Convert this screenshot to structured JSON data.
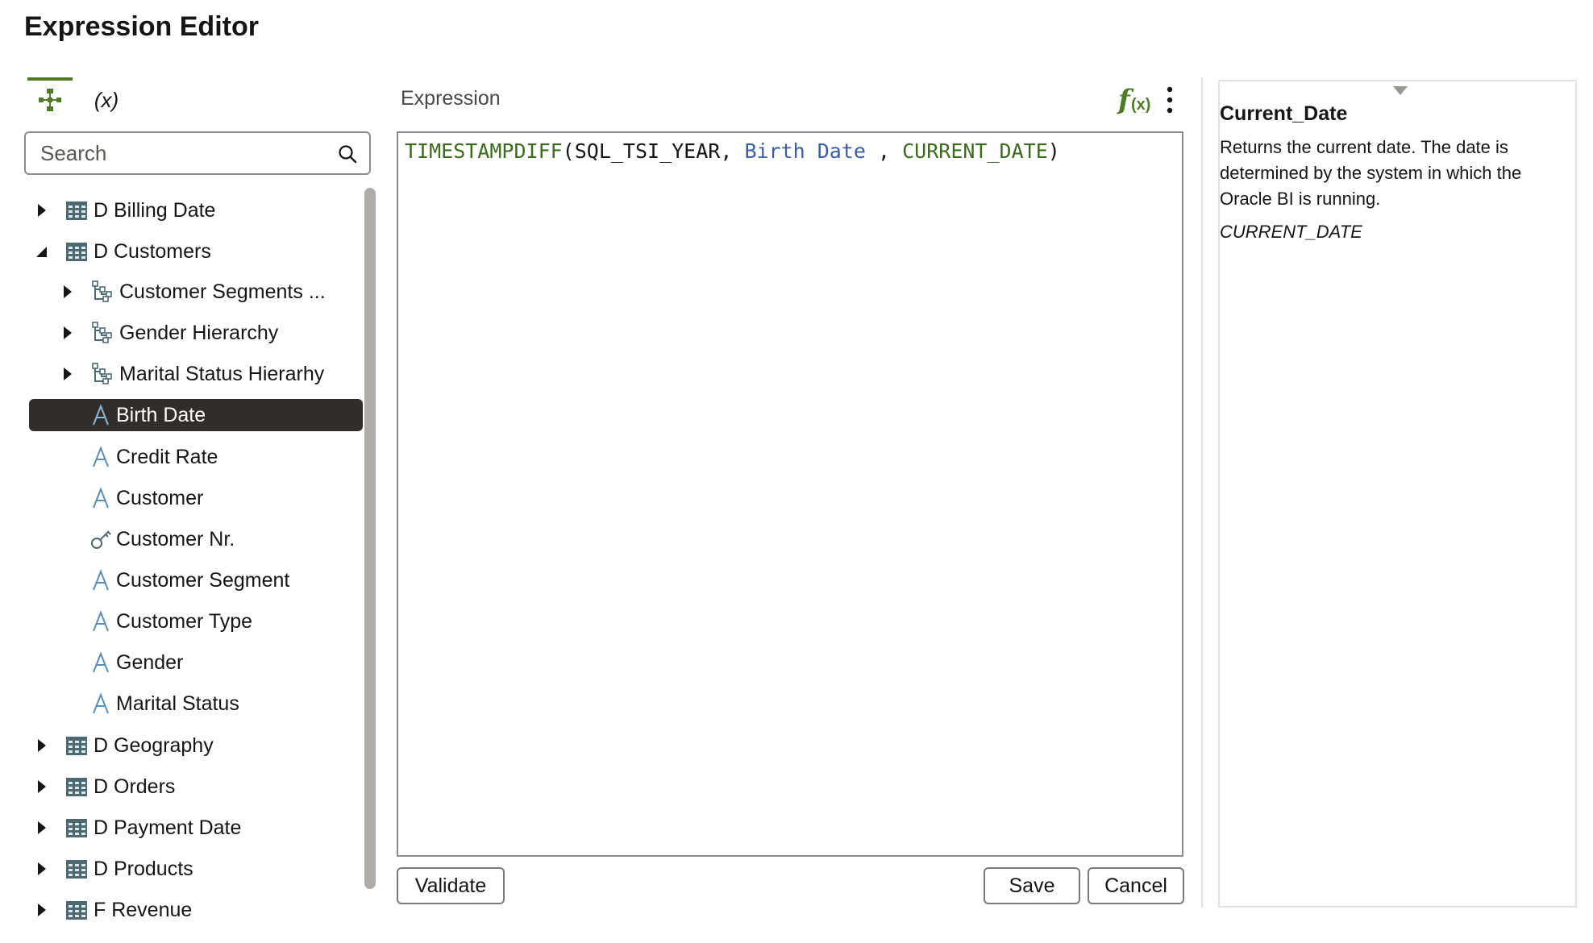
{
  "page": {
    "title": "Expression Editor"
  },
  "left_tabs": [
    {
      "name": "fields-tab",
      "icon": "fields-icon",
      "label": ""
    },
    {
      "name": "variables-tab",
      "label": "(x)"
    }
  ],
  "search": {
    "placeholder": "Search",
    "value": ""
  },
  "tree": {
    "items": [
      {
        "label": "D Billing Date",
        "icon": "table-icon",
        "expander": "collapsed",
        "level": 0
      },
      {
        "label": "D Customers",
        "icon": "table-icon",
        "expander": "expanded",
        "level": 0
      },
      {
        "label": "Customer Segments ...",
        "icon": "hierarchy-icon",
        "expander": "collapsed",
        "level": 1
      },
      {
        "label": "Gender Hierarchy",
        "icon": "hierarchy-icon",
        "expander": "collapsed",
        "level": 1
      },
      {
        "label": "Marital Status Hierarhy",
        "icon": "hierarchy-icon",
        "expander": "collapsed",
        "level": 1
      },
      {
        "label": "Birth Date",
        "icon": "attribute-icon",
        "expander": "none",
        "level": 2,
        "selected": true
      },
      {
        "label": "Credit Rate",
        "icon": "attribute-icon",
        "expander": "none",
        "level": 2
      },
      {
        "label": "Customer",
        "icon": "attribute-icon",
        "expander": "none",
        "level": 2
      },
      {
        "label": "Customer Nr.",
        "icon": "key-icon",
        "expander": "none",
        "level": 2
      },
      {
        "label": "Customer Segment",
        "icon": "attribute-icon",
        "expander": "none",
        "level": 2
      },
      {
        "label": "Customer Type",
        "icon": "attribute-icon",
        "expander": "none",
        "level": 2
      },
      {
        "label": "Gender",
        "icon": "attribute-icon",
        "expander": "none",
        "level": 2
      },
      {
        "label": "Marital Status",
        "icon": "attribute-icon",
        "expander": "none",
        "level": 2
      },
      {
        "label": "D Geography",
        "icon": "table-icon",
        "expander": "collapsed",
        "level": 0
      },
      {
        "label": "D Orders",
        "icon": "table-icon",
        "expander": "collapsed",
        "level": 0
      },
      {
        "label": "D Payment Date",
        "icon": "table-icon",
        "expander": "collapsed",
        "level": 0
      },
      {
        "label": "D Products",
        "icon": "table-icon",
        "expander": "collapsed",
        "level": 0
      },
      {
        "label": "F Revenue",
        "icon": "fact-table-icon",
        "expander": "collapsed",
        "level": 0
      }
    ]
  },
  "editor": {
    "label": "Expression",
    "functions_icon": "fx-icon",
    "menu_icon": "kebab-menu-icon",
    "tokens": [
      {
        "text": "TIMESTAMPDIFF",
        "kind": "function"
      },
      {
        "text": "(SQL_TSI_YEAR, ",
        "kind": "plain"
      },
      {
        "text": "Birth Date",
        "kind": "column"
      },
      {
        "text": " , ",
        "kind": "plain"
      },
      {
        "text": "CURRENT_DATE",
        "kind": "function"
      },
      {
        "text": ")",
        "kind": "plain"
      }
    ]
  },
  "buttons": {
    "validate": "Validate",
    "save": "Save",
    "cancel": "Cancel"
  },
  "help": {
    "title": "Current_Date",
    "description": "Returns the current date. The date is determined by the system in which the Oracle BI is running.",
    "syntax": "CURRENT_DATE"
  },
  "colors": {
    "accent_green": "#4f7a28",
    "function_token": "#3d6b1e",
    "column_token": "#3a5da8",
    "selected_row_bg": "#312d2a",
    "attribute_icon": "#5b8db8"
  }
}
